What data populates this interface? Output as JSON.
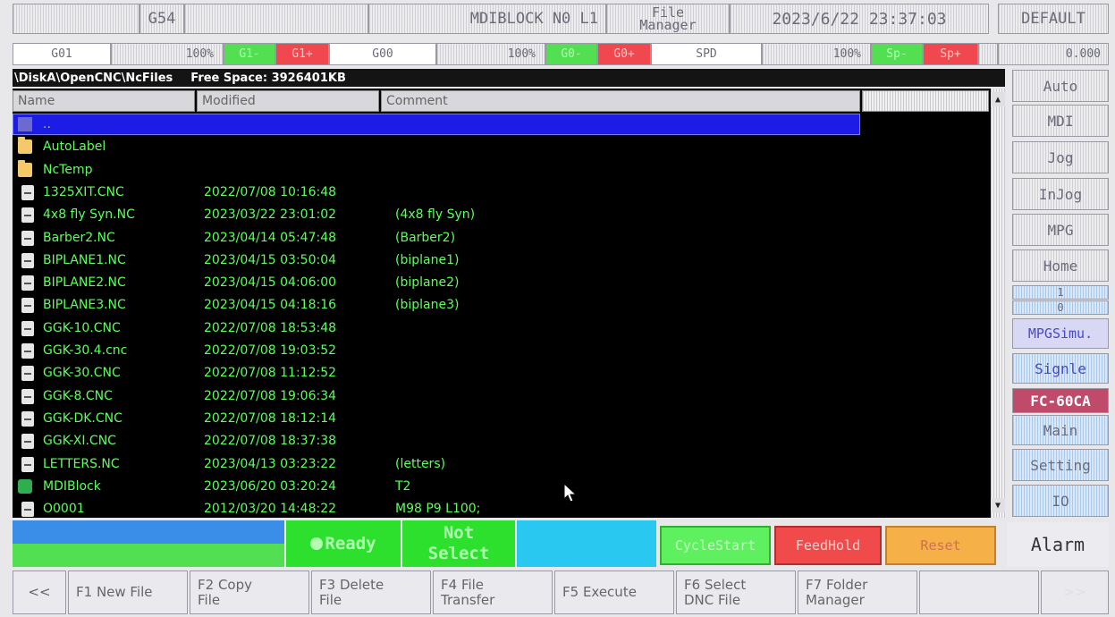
{
  "header": {
    "coord": "G54",
    "mode": "MDIBLOCK  N0  L1",
    "screen_title_line1": "File",
    "screen_title_line2": "Manager",
    "datetime": "2023/6/22 23:37:03",
    "profile": "DEFAULT"
  },
  "overrides": {
    "feed_code": "G01",
    "feed_pct": "100%",
    "feed_minus": "G1-",
    "feed_plus": "G1+",
    "rapid_code": "G00",
    "rapid_pct": "100%",
    "rapid_minus": "G0-",
    "rapid_plus": "G0+",
    "spindle_code": "SPD",
    "spindle_pct": "100%",
    "spindle_minus": "Sp-",
    "spindle_plus": "Sp+",
    "value": "0.000"
  },
  "path": {
    "location": "\\DiskA\\OpenCNC\\NcFiles",
    "free_space": "Free Space: 3926401KB"
  },
  "columns": {
    "name": "Name",
    "modified": "Modified",
    "comment": "Comment"
  },
  "files": [
    {
      "type": "parent",
      "name": "..",
      "modified": "",
      "comment": ""
    },
    {
      "type": "folder",
      "name": "AutoLabel",
      "modified": "",
      "comment": ""
    },
    {
      "type": "folder",
      "name": "NcTemp",
      "modified": "",
      "comment": ""
    },
    {
      "type": "file",
      "name": "1325XIT.CNC",
      "modified": "2022/07/08 10:16:48",
      "comment": ""
    },
    {
      "type": "file",
      "name": "4x8 fly Syn.NC",
      "modified": "2023/03/22 23:01:02",
      "comment": "(4x8 fly Syn)"
    },
    {
      "type": "file",
      "name": "Barber2.NC",
      "modified": "2023/04/14 05:47:48",
      "comment": "(Barber2)"
    },
    {
      "type": "file",
      "name": "BIPLANE1.NC",
      "modified": "2023/04/15 03:50:04",
      "comment": "(biplane1)"
    },
    {
      "type": "file",
      "name": "BIPLANE2.NC",
      "modified": "2023/04/15 04:06:00",
      "comment": "(biplane2)"
    },
    {
      "type": "file",
      "name": "BIPLANE3.NC",
      "modified": "2023/04/15 04:18:16",
      "comment": "(biplane3)"
    },
    {
      "type": "file",
      "name": "GGK-10.CNC",
      "modified": "2022/07/08 18:53:48",
      "comment": ""
    },
    {
      "type": "file",
      "name": "GGK-30.4.cnc",
      "modified": "2022/07/08 19:03:52",
      "comment": ""
    },
    {
      "type": "file",
      "name": "GGK-30.CNC",
      "modified": "2022/07/08 11:12:52",
      "comment": ""
    },
    {
      "type": "file",
      "name": "GGK-8.CNC",
      "modified": "2022/07/08 19:06:34",
      "comment": ""
    },
    {
      "type": "file",
      "name": "GGK-DK.CNC",
      "modified": "2022/07/08 18:12:14",
      "comment": ""
    },
    {
      "type": "file",
      "name": "GGK-XI.CNC",
      "modified": "2022/07/08 18:37:38",
      "comment": ""
    },
    {
      "type": "file",
      "name": "LETTERS.NC",
      "modified": "2023/04/13 03:23:22",
      "comment": "(letters)"
    },
    {
      "type": "mdi",
      "name": "MDIBlock",
      "modified": "2023/06/20 03:20:24",
      "comment": "T2"
    },
    {
      "type": "file",
      "name": "O0001",
      "modified": "2012/03/20 14:48:22",
      "comment": "M98 P9 L100;"
    }
  ],
  "sidebar": {
    "modes": [
      "Auto",
      "MDI",
      "Jog",
      "InJog",
      "MPG",
      "Home"
    ],
    "mpg_top": "1",
    "mpg_bottom": "0",
    "mpg_simu": "MPGSimu.",
    "single": "Signle",
    "model": "FC-60CA",
    "main": "Main",
    "setting": "Setting",
    "io": "IO"
  },
  "status": {
    "ready": "Ready",
    "not_select_1": "Not",
    "not_select_2": "Select",
    "cycle_start": "CycleStart",
    "feed_hold": "FeedHold",
    "reset": "Reset",
    "alarm": "Alarm"
  },
  "fkeys": {
    "prev": "<<",
    "f1": [
      "F1 New File",
      ""
    ],
    "f2": [
      "F2 Copy",
      "File"
    ],
    "f3": [
      "F3 Delete",
      "File"
    ],
    "f4": [
      "F4 File",
      "Transfer"
    ],
    "f5": [
      "F5 Execute",
      ""
    ],
    "f6": [
      "F6 Select",
      "DNC File"
    ],
    "f7": [
      "F7 Folder",
      "Manager"
    ],
    "next": ">>"
  },
  "colors": {
    "screen_bg": "#000000",
    "file_text": "#5dff5d",
    "selection": "#1c1ce6",
    "ready_green": "#52e052",
    "feedhold_red": "#f0484e",
    "reset_orange": "#f5b048"
  }
}
